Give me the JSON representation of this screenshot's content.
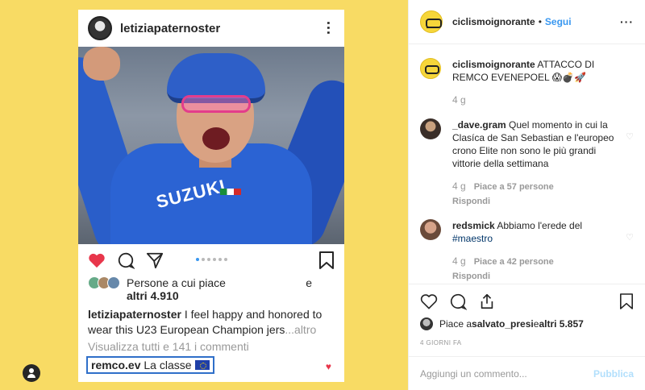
{
  "post_image": {
    "username": "letiziapaternoster",
    "more_icon": "more-vertical-icon",
    "kit_logo_text": "SUZUKI",
    "likes_label": "Persone a cui piace",
    "likes_suffix": "e",
    "likes_others": "altri 4.910",
    "caption_user": "letiziapaternoster",
    "caption_text": " I feel happy and honored to wear this U23 European Champion jers",
    "caption_more": "...altro",
    "view_all": "Visualizza tutti e 141 i commenti",
    "comment_user": "remco.ev",
    "comment_text": " La classe",
    "comment_highlight_color": "#2f6fc9",
    "carousel_dots": 6,
    "carousel_active": 0
  },
  "panel": {
    "account": "ciclismoignorante",
    "separator": "•",
    "follow_label": "Segui",
    "more_label": "···",
    "comments": [
      {
        "user": "ciclismoignorante",
        "text": " ATTACCO DI REMCO EVENEPOEL 😱💣🚀",
        "time": "4 g",
        "likes": "",
        "reply": ""
      },
      {
        "user": "_dave.gram",
        "text": " Quel momento in cui la Clasíca de San Sebastian e l'europeo crono Elite non sono le più grandi vittorie della settimana",
        "time": "4 g",
        "likes": "Piace a 57 persone",
        "reply": "Rispondi"
      },
      {
        "user": "redsmick",
        "text": " Abbiamo l'erede del ",
        "tag": "#maestro",
        "time": "4 g",
        "likes": "Piace a 42 persone",
        "reply": "Rispondi"
      }
    ],
    "liked_by_prefix": "Piace a ",
    "liked_by_user": "salvato_presi",
    "liked_by_suffix": " e ",
    "liked_by_others": "altri 5.857",
    "date": "4 GIORNI FA",
    "add_comment_placeholder": "Aggiungi un commento...",
    "publish_label": "Pubblica"
  },
  "colors": {
    "background_yellow": "#f8db64",
    "link_blue": "#3897f0",
    "publish_disabled": "#b2dffc",
    "like_red": "#e8364b"
  }
}
